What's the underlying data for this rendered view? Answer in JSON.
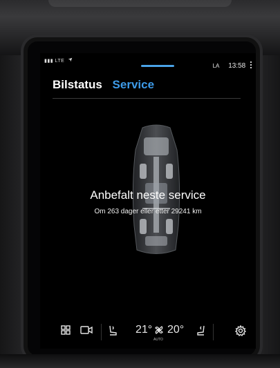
{
  "status_bar": {
    "network": "LTE",
    "profile": "LA",
    "time": "13:58"
  },
  "tabs": [
    {
      "label": "Bilstatus",
      "active": true
    },
    {
      "label": "Service",
      "active": false
    }
  ],
  "service": {
    "title": "Anbefalt neste service",
    "subtitle": "Om 263 dager eller etter 29241 km"
  },
  "climate": {
    "driver_temp": "21°",
    "passenger_temp": "20°",
    "fan_mode": "AUTO"
  },
  "colors": {
    "accent": "#3d9be9",
    "background": "#000000",
    "text": "#ffffff"
  },
  "icons": [
    "signal-icon",
    "navigation-arrow-icon",
    "more-icon",
    "car-xray-icon",
    "home-grid-icon",
    "camera-icon",
    "seat-heat-left-icon",
    "fan-icon",
    "seat-heat-right-icon",
    "settings-gear-icon"
  ]
}
